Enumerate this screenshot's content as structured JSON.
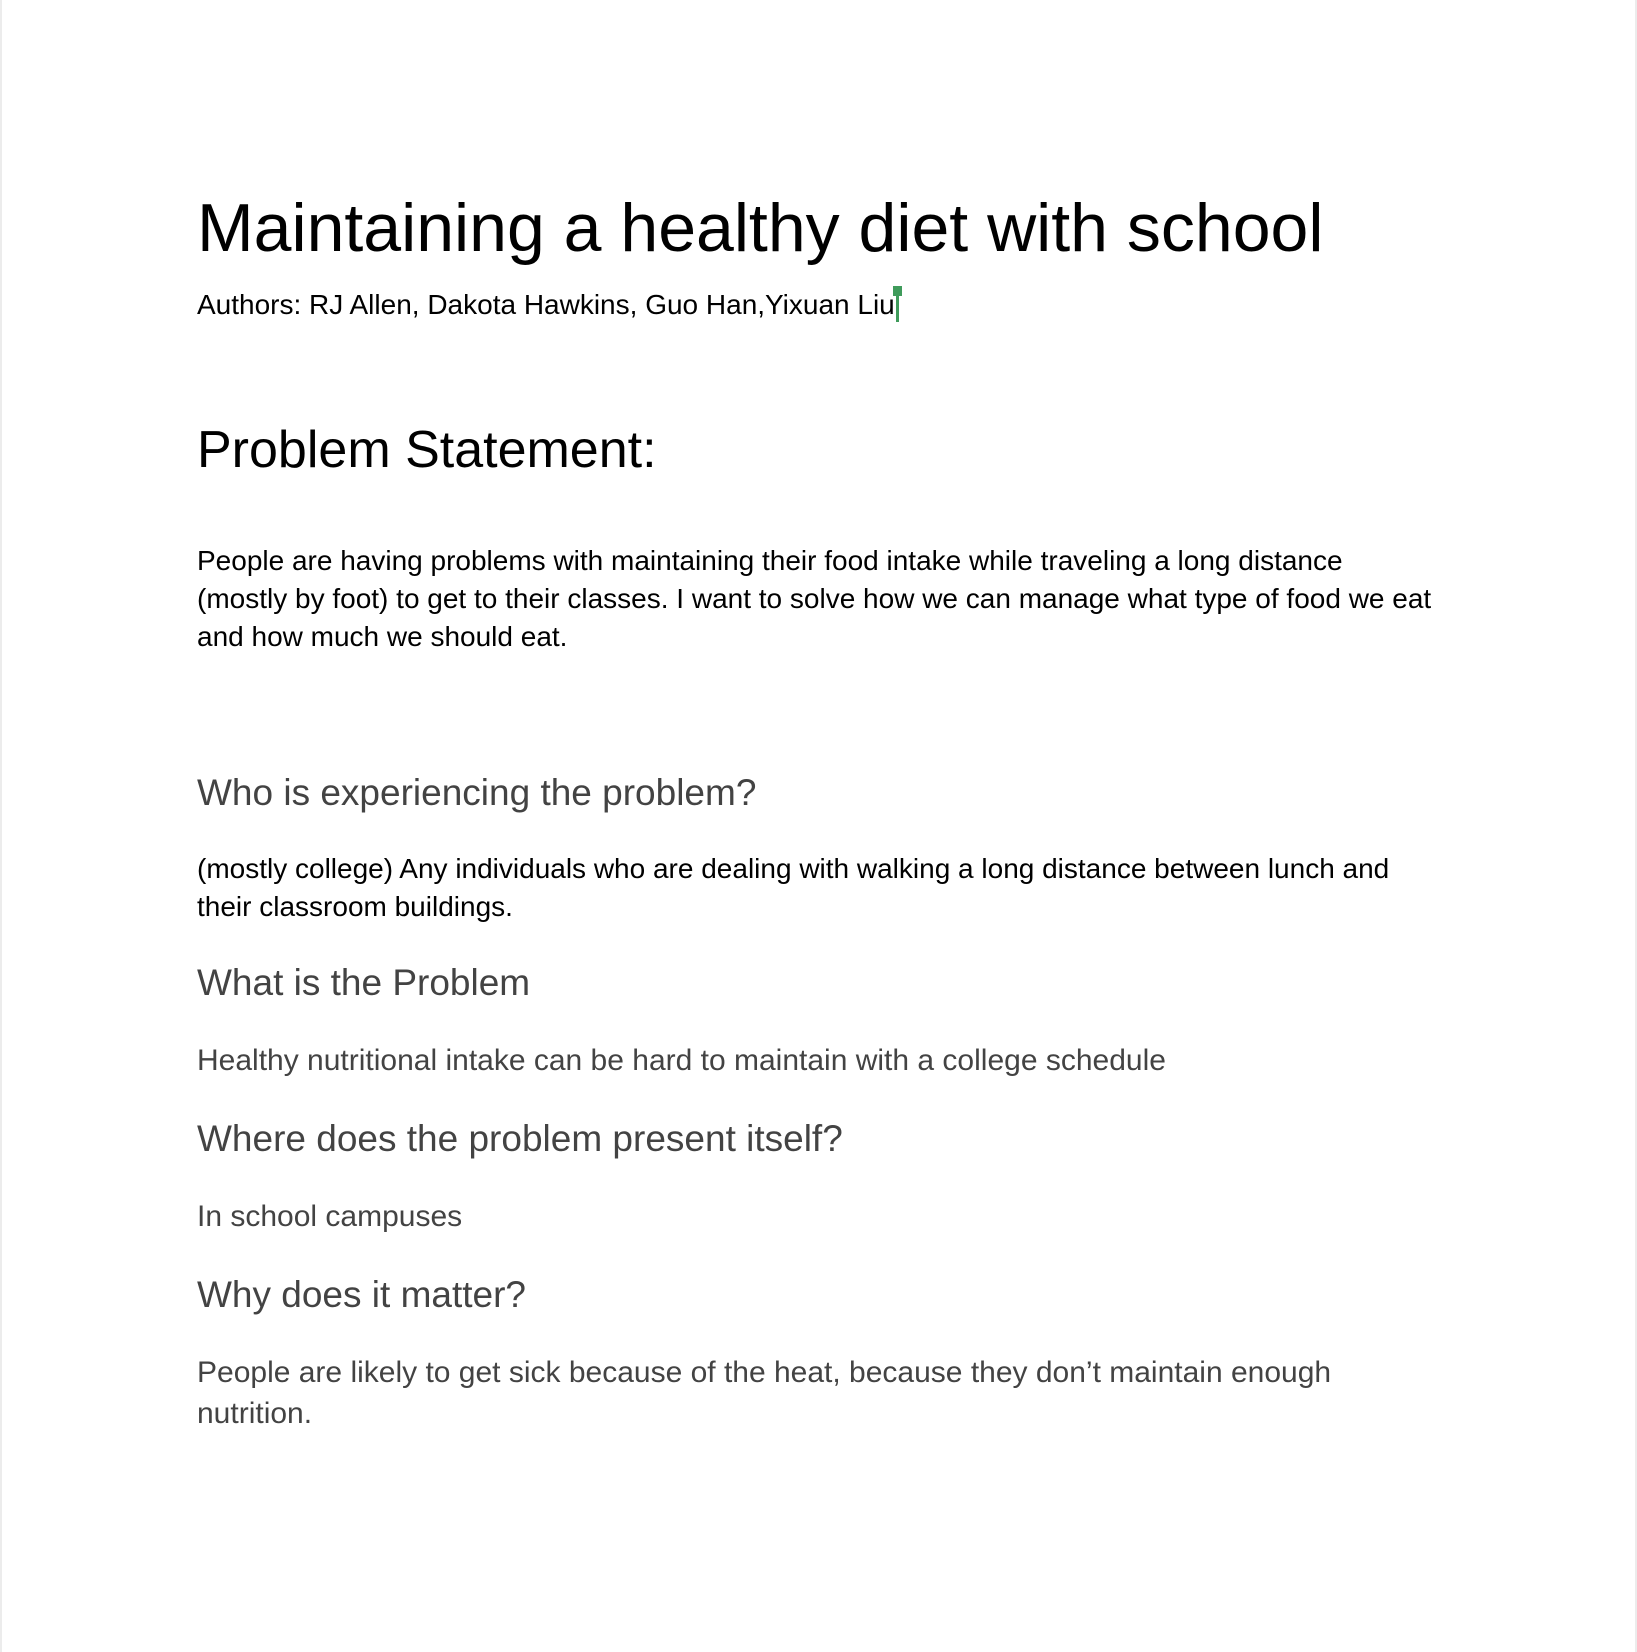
{
  "document": {
    "title": "Maintaining a healthy diet with school",
    "authors": "Authors: RJ Allen,  Dakota Hawkins, Guo Han,Yixuan Liu",
    "problem_statement": {
      "heading": "Problem Statement:",
      "body": "People are having problems with maintaining their food intake while traveling a long distance (mostly by foot) to get to their classes. I want to solve how we can manage what type of food we eat and how much we should eat."
    },
    "sections": [
      {
        "heading": "Who is experiencing the problem?",
        "body": "(mostly college) Any individuals who are dealing with walking a long distance between lunch and their classroom buildings."
      },
      {
        "heading": "What is the Problem",
        "body": "Healthy nutritional intake can be hard to maintain with a college schedule"
      },
      {
        "heading": "Where does the problem present itself?",
        "body": "In school campuses"
      },
      {
        "heading": "Why does it matter?",
        "body": "People are likely to get sick because of the heat, because they don’t maintain enough nutrition."
      }
    ],
    "colors": {
      "cursor": "#3f9b5b",
      "subheading": "#434343",
      "text": "#000000"
    }
  }
}
